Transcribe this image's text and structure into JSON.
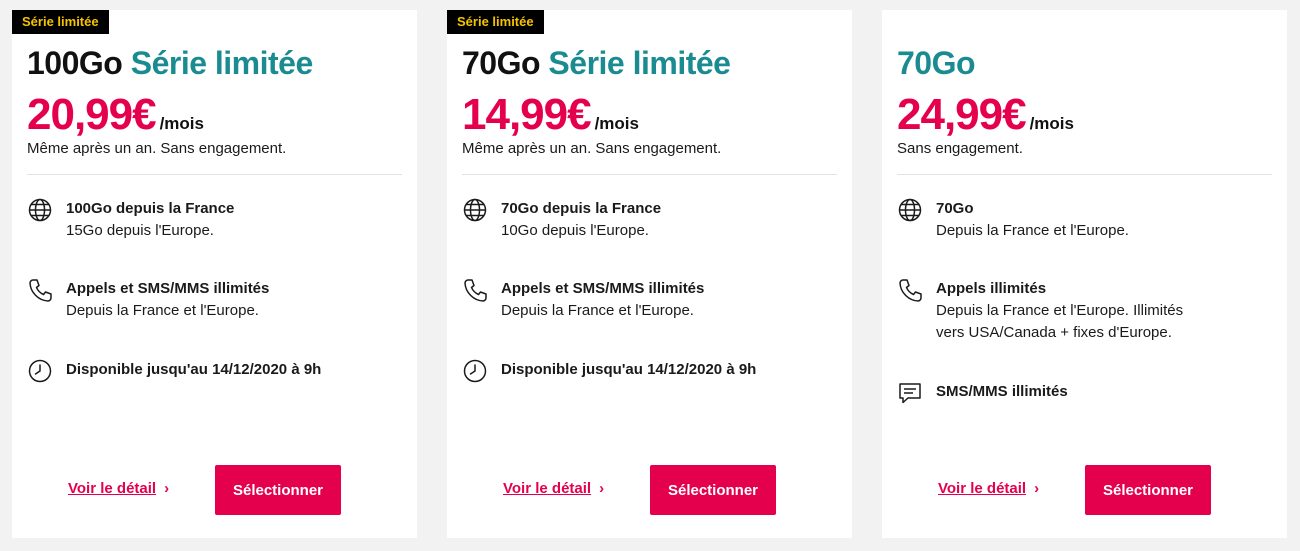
{
  "colors": {
    "accent_pink": "#e5004e",
    "accent_teal": "#1a8c91",
    "badge_bg": "#000000",
    "badge_text": "#f5c400"
  },
  "cards": [
    {
      "badge": "Série limitée",
      "title_data": "100Go",
      "title_series": "Série limitée",
      "price": "20,99€",
      "per_month": "/mois",
      "conditions": "Même après un an. Sans engagement.",
      "features": [
        {
          "icon": "globe-icon",
          "title": "100Go depuis la France",
          "desc": "15Go depuis l'Europe."
        },
        {
          "icon": "phone-icon",
          "title": "Appels et SMS/MMS illimités",
          "desc": "Depuis la France et l'Europe."
        },
        {
          "icon": "clock-icon",
          "title": "Disponible jusqu'au 14/12/2020 à 9h",
          "desc": ""
        }
      ],
      "detail_link": "Voir le détail",
      "select_button": "Sélectionner"
    },
    {
      "badge": "Série limitée",
      "title_data": "70Go",
      "title_series": "Série limitée",
      "price": "14,99€",
      "per_month": "/mois",
      "conditions": "Même après un an. Sans engagement.",
      "features": [
        {
          "icon": "globe-icon",
          "title": "70Go depuis la France",
          "desc": "10Go depuis l'Europe."
        },
        {
          "icon": "phone-icon",
          "title": "Appels et SMS/MMS illimités",
          "desc": "Depuis la France et l'Europe."
        },
        {
          "icon": "clock-icon",
          "title": "Disponible jusqu'au 14/12/2020 à 9h",
          "desc": ""
        }
      ],
      "detail_link": "Voir le détail",
      "select_button": "Sélectionner"
    },
    {
      "badge": "",
      "title_data": "70Go",
      "title_series": "",
      "price": "24,99€",
      "per_month": "/mois",
      "conditions": "Sans engagement.",
      "features": [
        {
          "icon": "globe-icon",
          "title": "70Go",
          "desc": "Depuis la France et l'Europe."
        },
        {
          "icon": "phone-icon",
          "title": "Appels illimités",
          "desc": "Depuis la France et l'Europe. Illimités vers USA/Canada + fixes d'Europe."
        },
        {
          "icon": "chat-bubble-icon",
          "title": "SMS/MMS illimités",
          "desc": ""
        }
      ],
      "detail_link": "Voir le détail",
      "select_button": "Sélectionner"
    }
  ]
}
